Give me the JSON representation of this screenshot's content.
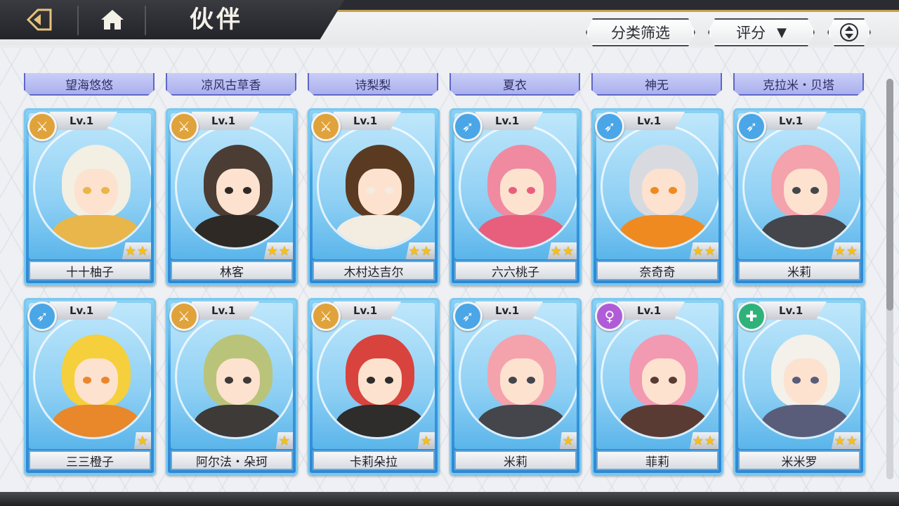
{
  "header": {
    "title": "伙伴",
    "back_icon": "back-arrow-icon",
    "home_icon": "home-icon"
  },
  "toolbar": {
    "filter_label": "分类筛选",
    "sort_label": "评分",
    "sort_arrow": "▼",
    "order_icon": "sort-order-icon"
  },
  "peek_row": [
    "望海悠悠",
    "凉风古草香",
    "诗梨梨",
    "夏衣",
    "神无",
    "克拉米・贝塔"
  ],
  "colors": {
    "card_blue": "#3d9fe0",
    "badge_gold": "#e0a23a",
    "badge_blue": "#4aa6e6",
    "badge_purple": "#b05cd6",
    "badge_green": "#2fb27a",
    "star": "#f5c018"
  },
  "cards": [
    {
      "name": "十十柚子",
      "level": "Lv.1",
      "stars": 2,
      "class": "sword",
      "hair": "#f3efe2",
      "accent": "#e8b64a"
    },
    {
      "name": "林客",
      "level": "Lv.1",
      "stars": 2,
      "class": "sword",
      "hair": "#4b3d33",
      "accent": "#2e2925"
    },
    {
      "name": "木村达吉尔",
      "level": "Lv.1",
      "stars": 2,
      "class": "sword",
      "hair": "#5b3a22",
      "accent": "#f2ece1"
    },
    {
      "name": "六六桃子",
      "level": "Lv.1",
      "stars": 2,
      "class": "bow",
      "hair": "#f08aa0",
      "accent": "#e85f7e"
    },
    {
      "name": "奈奇奇",
      "level": "Lv.1",
      "stars": 2,
      "class": "bow",
      "hair": "#d9dadf",
      "accent": "#ef8a20"
    },
    {
      "name": "米莉",
      "level": "Lv.1",
      "stars": 2,
      "class": "bow",
      "hair": "#f4a2ac",
      "accent": "#44464c"
    },
    {
      "name": "三三橙子",
      "level": "Lv.1",
      "stars": 1,
      "class": "bow",
      "hair": "#f6cf3c",
      "accent": "#e9872b"
    },
    {
      "name": "阿尔法・朵珂",
      "level": "Lv.1",
      "stars": 1,
      "class": "sword",
      "hair": "#b9c47a",
      "accent": "#3e3a38"
    },
    {
      "name": "卡莉朵拉",
      "level": "Lv.1",
      "stars": 1,
      "class": "sword",
      "hair": "#d9433d",
      "accent": "#2f2c2c"
    },
    {
      "name": "米莉",
      "level": "Lv.1",
      "stars": 1,
      "class": "bow",
      "hair": "#f4a2ac",
      "accent": "#44464c"
    },
    {
      "name": "菲莉",
      "level": "Lv.1",
      "stars": 2,
      "class": "magic",
      "hair": "#f29ab2",
      "accent": "#5a3b34"
    },
    {
      "name": "米米罗",
      "level": "Lv.1",
      "stars": 2,
      "class": "heal",
      "hair": "#f3f1ea",
      "accent": "#5a5d7a"
    }
  ]
}
